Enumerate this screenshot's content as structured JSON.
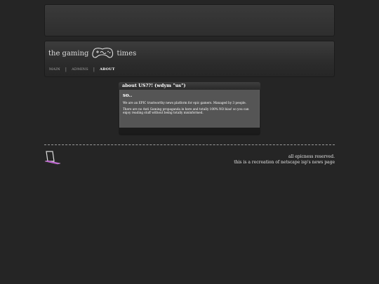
{
  "header": {
    "logo_left": "the gaming",
    "logo_right": "times",
    "nav": [
      {
        "label": "MAIN"
      },
      {
        "label": "ADMINS"
      },
      {
        "label": "ABOUT"
      }
    ]
  },
  "article": {
    "header": "about US??! (wdym \"us\")",
    "title": "so..",
    "paragraphs": [
      "We are an EPIC trustworthy news platform for epic gamers. Managed by 3 people.",
      "There are no Anti Gaming propaganda in here and totally 100% NO bias! so you can enjoy reading stuff without being totally misinformed."
    ]
  },
  "footer": {
    "line1": "all epicness reserved.",
    "line2": "this is a recreation of netscape isp's news page"
  },
  "icons": {
    "logo": "gamepad-icon",
    "footer": "laptop-icon"
  }
}
